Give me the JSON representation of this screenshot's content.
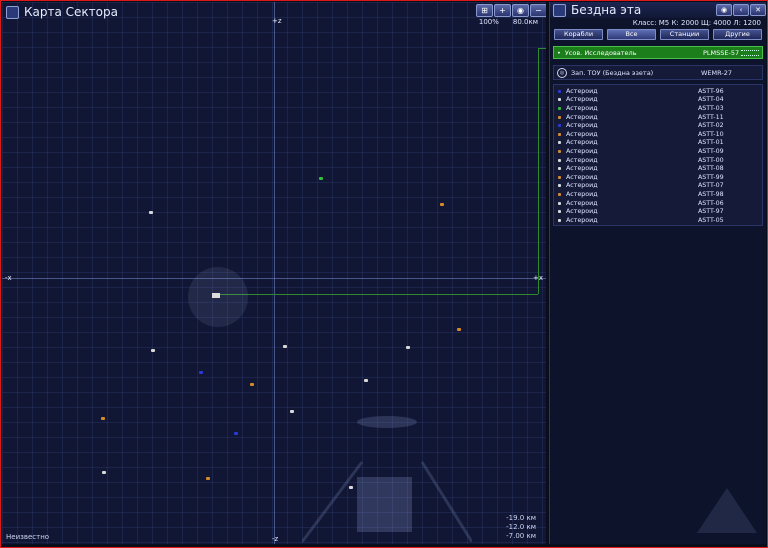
{
  "map": {
    "title": "Карта Сектора",
    "zoom_percent": "100%",
    "zoom_distance": "80.0км",
    "axis_labels": {
      "top": "+z",
      "bottom": "-z",
      "left": "-x",
      "right": "+x"
    },
    "status": "Неизвестно",
    "coords": [
      "-19.0 км",
      "-12.0 км",
      "-7.00 км"
    ],
    "toolbar": [
      "map-layers-icon",
      "plus-icon",
      "eye-icon",
      "minus-icon"
    ],
    "object_colors": {
      "asteroid_white": "#d8d8d8",
      "asteroid_orange": "#d58a2a",
      "asteroid_blue": "#2a3ad8",
      "asteroid_green": "#2fbf3a"
    }
  },
  "panel": {
    "title": "Бездна эта",
    "info": "Класс: M5  К: 2000  Щ: 4000  Л: 1200",
    "filters": [
      "Корабли",
      "Все",
      "Станции",
      "Другие"
    ],
    "active_filter": "Все",
    "selected": {
      "name": "Усов. Исследователь",
      "code": "PLMSSE-57"
    },
    "gate": {
      "name": "Зап. ТОУ (Бездна эзета)",
      "code": "WEMR-27"
    },
    "objects": [
      {
        "name": "Астероид",
        "code": "ASTT-96",
        "color": "#2a3ad8"
      },
      {
        "name": "Астероид",
        "code": "ASTT-04",
        "color": "#d8d8d8"
      },
      {
        "name": "Астероид",
        "code": "ASTT-03",
        "color": "#2fbf3a"
      },
      {
        "name": "Астероид",
        "code": "ASTT-11",
        "color": "#d58a2a"
      },
      {
        "name": "Астероид",
        "code": "ASTT-02",
        "color": "#2a3ad8"
      },
      {
        "name": "Астероид",
        "code": "ASTT-10",
        "color": "#d58a2a"
      },
      {
        "name": "Астероид",
        "code": "ASTT-01",
        "color": "#d8d8d8"
      },
      {
        "name": "Астероид",
        "code": "ASTT-09",
        "color": "#d58a2a"
      },
      {
        "name": "Астероид",
        "code": "ASTT-00",
        "color": "#d8d8d8"
      },
      {
        "name": "Астероид",
        "code": "ASTT-08",
        "color": "#d8d8d8"
      },
      {
        "name": "Астероид",
        "code": "ASTT-99",
        "color": "#d58a2a"
      },
      {
        "name": "Астероид",
        "code": "ASTT-07",
        "color": "#d8d8d8"
      },
      {
        "name": "Астероид",
        "code": "ASTT-98",
        "color": "#d58a2a"
      },
      {
        "name": "Астероид",
        "code": "ASTT-06",
        "color": "#d8d8d8"
      },
      {
        "name": "Астероид",
        "code": "ASTT-97",
        "color": "#d8d8d8"
      },
      {
        "name": "Астероид",
        "code": "ASTT-05",
        "color": "#d8d8d8"
      }
    ],
    "toolbar": [
      "eye-icon",
      "back-icon",
      "close-icon"
    ]
  }
}
